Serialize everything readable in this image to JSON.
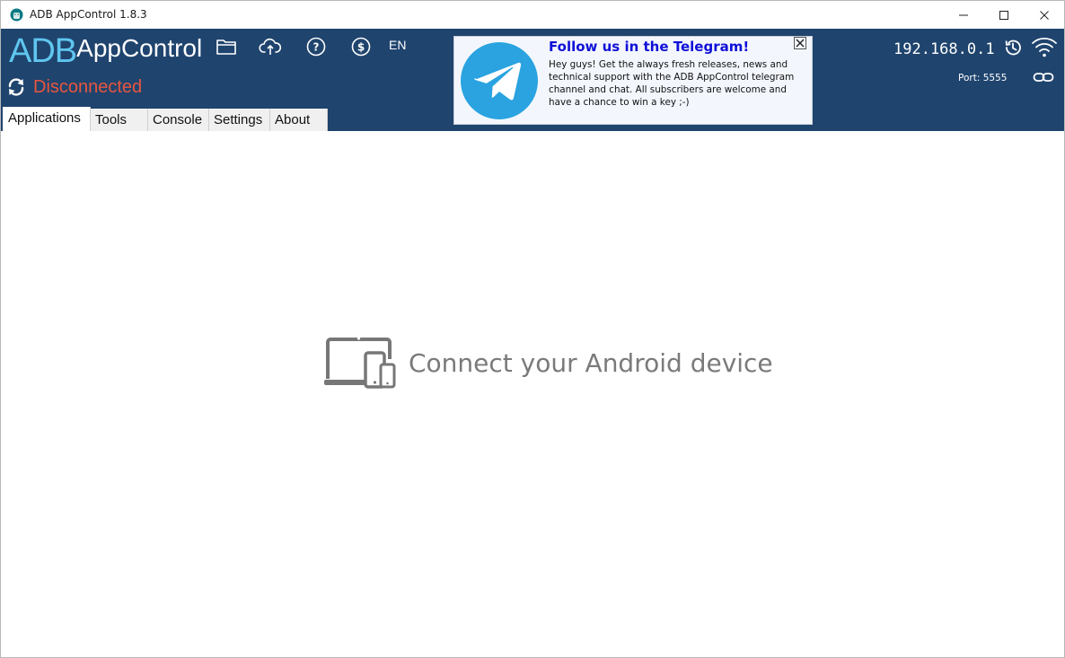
{
  "window": {
    "title": "ADB AppControl 1.8.3"
  },
  "header": {
    "logo_primary": "ADB",
    "logo_secondary": "AppControl",
    "language": "EN",
    "status": "Disconnected",
    "ip_address": "192.168.0.1",
    "port_label": "Port: 5555"
  },
  "banner": {
    "title": "Follow us in the Telegram!",
    "body": "Hey guys! Get the always fresh releases, news and technical support with the ADB AppControl telegram channel and chat. All subscribers are welcome and have a chance to win a key ;-)"
  },
  "tabs": [
    {
      "label": "Applications",
      "active": true
    },
    {
      "label": "Tools",
      "active": false
    },
    {
      "label": "Console",
      "active": false
    },
    {
      "label": "Settings",
      "active": false
    },
    {
      "label": "About",
      "active": false
    }
  ],
  "main": {
    "empty_message": "Connect your Android device"
  },
  "colors": {
    "header_bg": "#1f446e",
    "logo_accent": "#5fc6ef",
    "status_disconnected": "#e8553f",
    "telegram_blue": "#2aa3e0",
    "banner_title": "#1010d8"
  }
}
